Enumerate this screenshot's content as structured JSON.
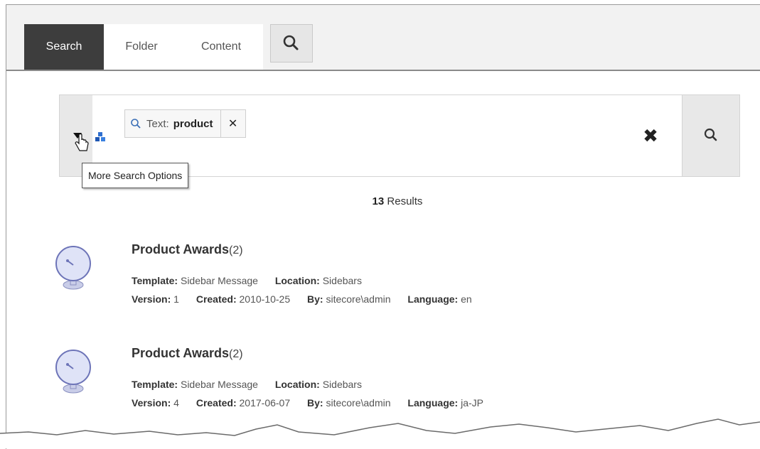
{
  "tabs": [
    {
      "label": "Search",
      "active": true
    },
    {
      "label": "Folder",
      "active": false
    },
    {
      "label": "Content",
      "active": false
    }
  ],
  "search_tab_icon": "search-icon",
  "searchbox": {
    "chip": {
      "label": "Text:",
      "value": "product",
      "icon": "search-icon"
    },
    "clear_icon": "close-icon",
    "go_icon": "search-icon"
  },
  "tooltip": "More Search Options",
  "results": {
    "count": "13",
    "count_label": "Results",
    "items": [
      {
        "title": "Product Awards",
        "count": "(2)",
        "template_label": "Template:",
        "template": "Sidebar Message",
        "location_label": "Location:",
        "location": "Sidebars",
        "version_label": "Version:",
        "version": "1",
        "created_label": "Created:",
        "created": "2010-10-25",
        "by_label": "By:",
        "by": "sitecore\\admin",
        "language_label": "Language:",
        "language": "en"
      },
      {
        "title": "Product Awards",
        "count": "(2)",
        "template_label": "Template:",
        "template": "Sidebar Message",
        "location_label": "Location:",
        "location": "Sidebars",
        "version_label": "Version:",
        "version": "4",
        "created_label": "Created:",
        "created": "2017-06-07",
        "by_label": "By:",
        "by": "sitecore\\admin",
        "language_label": "Language:",
        "language": "ja-JP"
      }
    ]
  }
}
